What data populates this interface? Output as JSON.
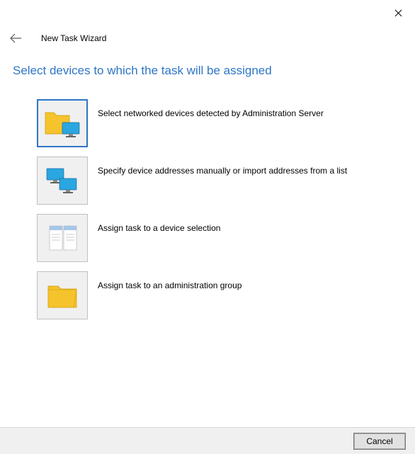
{
  "window": {
    "title": "New Task Wizard"
  },
  "heading": "Select devices to which the task will be assigned",
  "options": [
    {
      "label": "Select networked devices detected by Administration Server"
    },
    {
      "label": "Specify device addresses manually or import addresses from a list"
    },
    {
      "label": "Assign task to a device selection"
    },
    {
      "label": "Assign task to an administration group"
    }
  ],
  "footer": {
    "cancel_label": "Cancel"
  }
}
